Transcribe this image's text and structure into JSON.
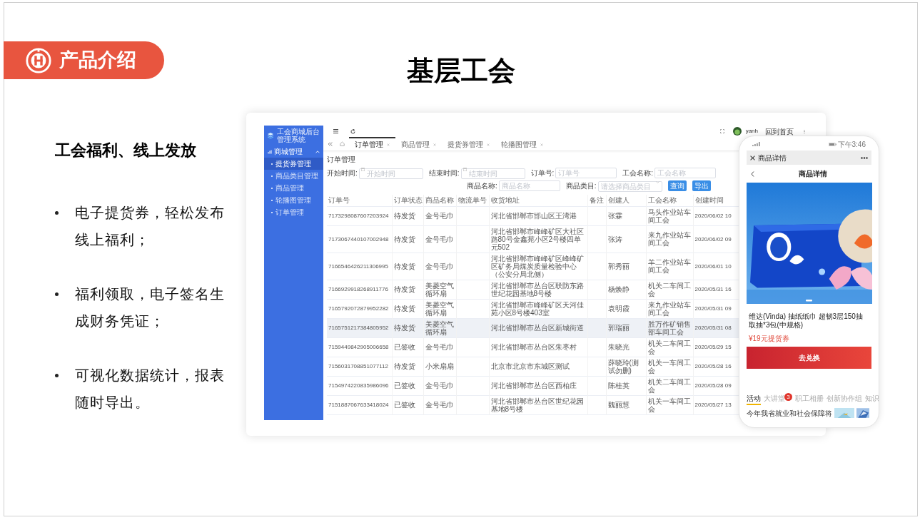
{
  "slide": {
    "badge": "产品介绍",
    "title": "基层工会",
    "subtitle": "工会福利、线上发放",
    "bullets": [
      "电子提货券，轻松发布线上福利；",
      "福利领取，电子签名生成财务凭证；",
      "可视化数据统计，报表随时导出。"
    ]
  },
  "admin": {
    "app_title": "工会商城后台管理系统",
    "sidebar": {
      "group": "商城管理",
      "expanded": true,
      "items": [
        {
          "label": "提货券管理",
          "selected": true
        },
        {
          "label": "商品类目管理",
          "selected": false
        },
        {
          "label": "商品管理",
          "selected": false
        },
        {
          "label": "轮播图管理",
          "selected": false
        },
        {
          "label": "订单管理",
          "selected": false
        }
      ]
    },
    "header": {
      "user": "yanh",
      "home_link": "回到首页"
    },
    "tabs": [
      {
        "label": "订单管理",
        "selected": true
      },
      {
        "label": "商品管理",
        "selected": false
      },
      {
        "label": "提货券管理",
        "selected": false
      },
      {
        "label": "轮播图管理",
        "selected": false
      }
    ],
    "form": {
      "title": "订单管理",
      "fields": [
        {
          "label": "开始时间:",
          "placeholder": "开始时间",
          "kind": "date"
        },
        {
          "label": "结束时间:",
          "placeholder": "结束时间",
          "kind": "date"
        },
        {
          "label": "订单号:",
          "placeholder": "订单号",
          "kind": "text"
        },
        {
          "label": "工会名称:",
          "placeholder": "工会名称",
          "kind": "text"
        },
        {
          "label": "商品名称:",
          "placeholder": "商品名称",
          "kind": "text"
        },
        {
          "label": "商品类目:",
          "placeholder": "请选择商品类目",
          "kind": "select"
        }
      ],
      "buttons": [
        "查询",
        "导出"
      ]
    },
    "table": {
      "columns": [
        "订单号",
        "订单状态",
        "商品名称",
        "物流单号",
        "收货地址",
        "备注",
        "创建人",
        "工会名称",
        "创建时间"
      ],
      "rows": [
        {
          "highlighted": false,
          "cells": [
            "7173298087607203924",
            "待发货",
            "金号毛巾",
            "",
            "河北省邯郸市邯山区王湾港",
            "",
            "张霖",
            "马头作业站车间工会",
            "2020/06/02 10"
          ]
        },
        {
          "highlighted": false,
          "cells": [
            "7173067440107002948",
            "待发货",
            "金号毛巾",
            "",
            "河北省邯郸市峰峰矿区大社区路80号金鑫苑小区2号楼四单元502",
            "",
            "张涛",
            "来九作业站车间工会",
            "2020/06/02 09"
          ]
        },
        {
          "highlighted": false,
          "cells": [
            "7166546426211306995",
            "待发货",
            "金号毛巾",
            "",
            "河北省邯郸市峰峰矿区峰峰矿区矿务局煤炭质量检验中心（公安分局北侧）",
            "",
            "郭秀丽",
            "羊二作业站车间工会",
            "2020/06/01 10"
          ]
        },
        {
          "highlighted": false,
          "cells": [
            "7166929918268911776",
            "待发货",
            "美菱空气循环扇",
            "",
            "河北省邯郸市丛台区联防东路世纪花园基地8号楼",
            "",
            "杨焕静",
            "机关二车间工会",
            "2020/05/31 16"
          ]
        },
        {
          "highlighted": false,
          "cells": [
            "7165792072879952282",
            "待发货",
            "美菱空气循环扇",
            "",
            "河北省邯郸市峰峰矿区天河佳苑小区8号楼403室",
            "",
            "袁明霞",
            "来九作业站车间工会",
            "2020/05/31 09"
          ]
        },
        {
          "highlighted": true,
          "cells": [
            "7165751217384805952",
            "待发货",
            "美菱空气循环扇",
            "",
            "河北省邯郸市丛台区新城街道",
            "",
            "郭瑞丽",
            "胜万作矿销售部车间工会",
            "2020/05/31 08"
          ]
        },
        {
          "highlighted": false,
          "cells": [
            "7159449842905006658",
            "已签收",
            "金号毛巾",
            "",
            "河北省邯郸市丛台区朱枣村",
            "",
            "朱晓光",
            "机关二车间工会",
            "2020/05/29 15"
          ]
        },
        {
          "highlighted": false,
          "cells": [
            "7156031708851077112",
            "待发货",
            "小米扇扇",
            "",
            "北京市北京市东城区测试",
            "",
            "薛晓玲(测试勿删)",
            "机关一车间工会",
            "2020/05/28 16"
          ]
        },
        {
          "highlighted": false,
          "cells": [
            "7154974220835986096",
            "已签收",
            "金号毛巾",
            "",
            "河北省邯郸市丛台区西柏庄",
            "",
            "陈桂英",
            "机关二车间工会",
            "2020/05/28 09"
          ]
        },
        {
          "highlighted": false,
          "cells": [
            "7151887067633418024",
            "已签收",
            "金号毛巾",
            "",
            "河北省邯郸市丛台区世纪花园基地8号楼",
            "",
            "魏丽慧",
            "机关一车间工会",
            "2020/05/27 13"
          ]
        }
      ]
    }
  },
  "phone": {
    "status_time": "下午3:46",
    "window_title": "商品详情",
    "page_title": "商品详情",
    "product": {
      "name": "维达(Vinda) 抽纸纸巾 超韧3层150抽取抽*3包(中规格)",
      "price": "¥19元提货券"
    },
    "action_button": "去兑换",
    "tabs": [
      {
        "label": "活动",
        "selected": true
      },
      {
        "label": "大讲堂",
        "selected": false,
        "badge": "3"
      },
      {
        "label": "职工相册",
        "selected": false
      },
      {
        "label": "创新协作组",
        "selected": false
      },
      {
        "label": "知识",
        "selected": false
      }
    ],
    "news": [
      {
        "title": "今年我省就业和社会保障将"
      }
    ]
  }
}
